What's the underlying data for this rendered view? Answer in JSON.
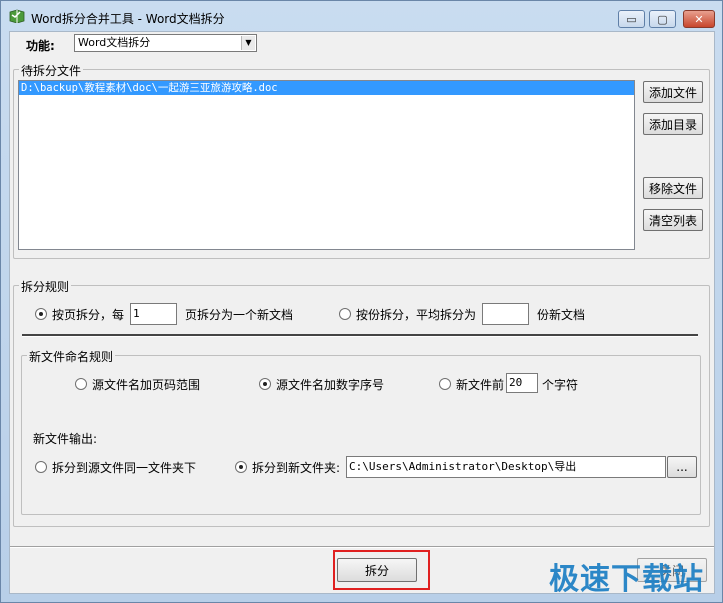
{
  "window": {
    "title": "Word拆分合并工具 - Word文档拆分",
    "controls": {
      "minimize": "▭",
      "maximize": "▢",
      "close": "✕"
    }
  },
  "function": {
    "label": "功能:",
    "selected": "Word文档拆分"
  },
  "files_group": {
    "title": "待拆分文件",
    "items": [
      "D:\\backup\\教程素材\\doc\\一起游三亚旅游攻略.doc"
    ],
    "buttons": {
      "add_file": "添加文件",
      "add_dir": "添加目录",
      "remove_file": "移除文件",
      "clear_list": "清空列表"
    }
  },
  "split_rule": {
    "title": "拆分规则",
    "by_page_label": "按页拆分，每",
    "pages_value": "1",
    "by_page_suffix": "页拆分为一个新文档",
    "by_count_label": "按份拆分，平均拆分为",
    "count_value": "",
    "by_count_suffix": "份新文档",
    "selected": "by_page"
  },
  "naming": {
    "title": "新文件命名规则",
    "opt_page_range": "源文件名加页码范围",
    "opt_number": "源文件名加数字序号",
    "opt_prefix": "新文件前",
    "prefix_chars": "20",
    "prefix_suffix": "个字符",
    "selected": "number"
  },
  "output": {
    "label": "新文件输出:",
    "opt_same_folder": "拆分到源文件同一文件夹下",
    "opt_new_folder": "拆分到新文件夹:",
    "folder_path": "C:\\Users\\Administrator\\Desktop\\导出",
    "browse": "...",
    "selected": "new_folder"
  },
  "actions": {
    "split": "拆分",
    "close": "关闭"
  },
  "watermark": "极速下载站",
  "colors": {
    "selection": "#3399ff",
    "highlight": "#e02020",
    "watermark": "#1c7fc4"
  }
}
